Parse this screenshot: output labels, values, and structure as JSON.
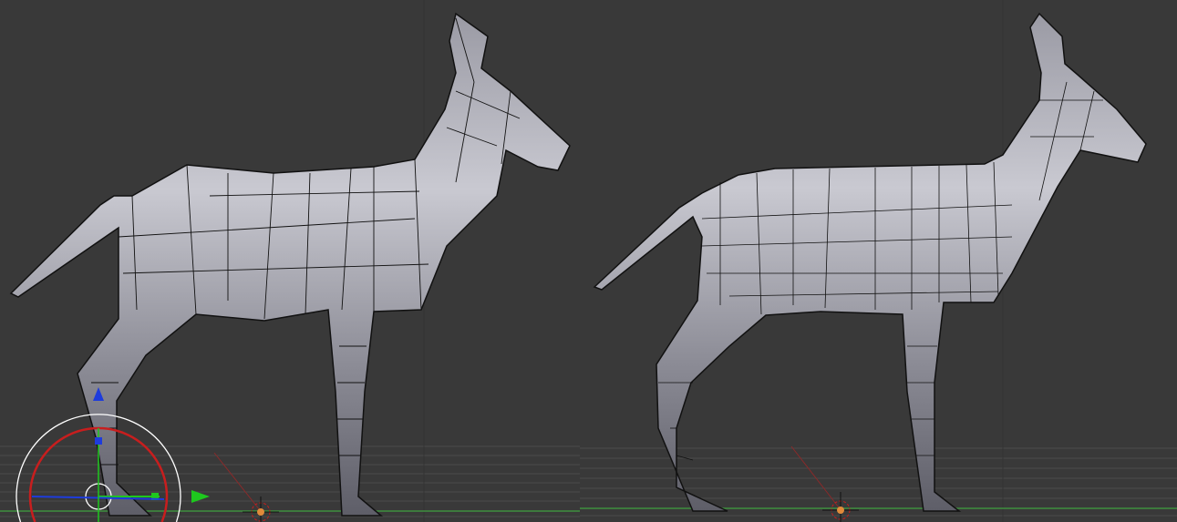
{
  "colors": {
    "background": "#393939",
    "grid": "#4a4a4a",
    "x_axis": "#3f8f3f",
    "mesh_light": "#c8c8d0",
    "mesh_dark": "#6a6a74",
    "wire": "#111111",
    "gizmo_red": "#c81e1e",
    "gizmo_green": "#1ec81e",
    "gizmo_blue": "#1e3cdc",
    "cursor_orange": "#e08a3a"
  },
  "viewports": [
    {
      "name": "left-viewport",
      "object": "deer-low-poly"
    },
    {
      "name": "right-viewport",
      "object": "deer-subdivided"
    }
  ]
}
